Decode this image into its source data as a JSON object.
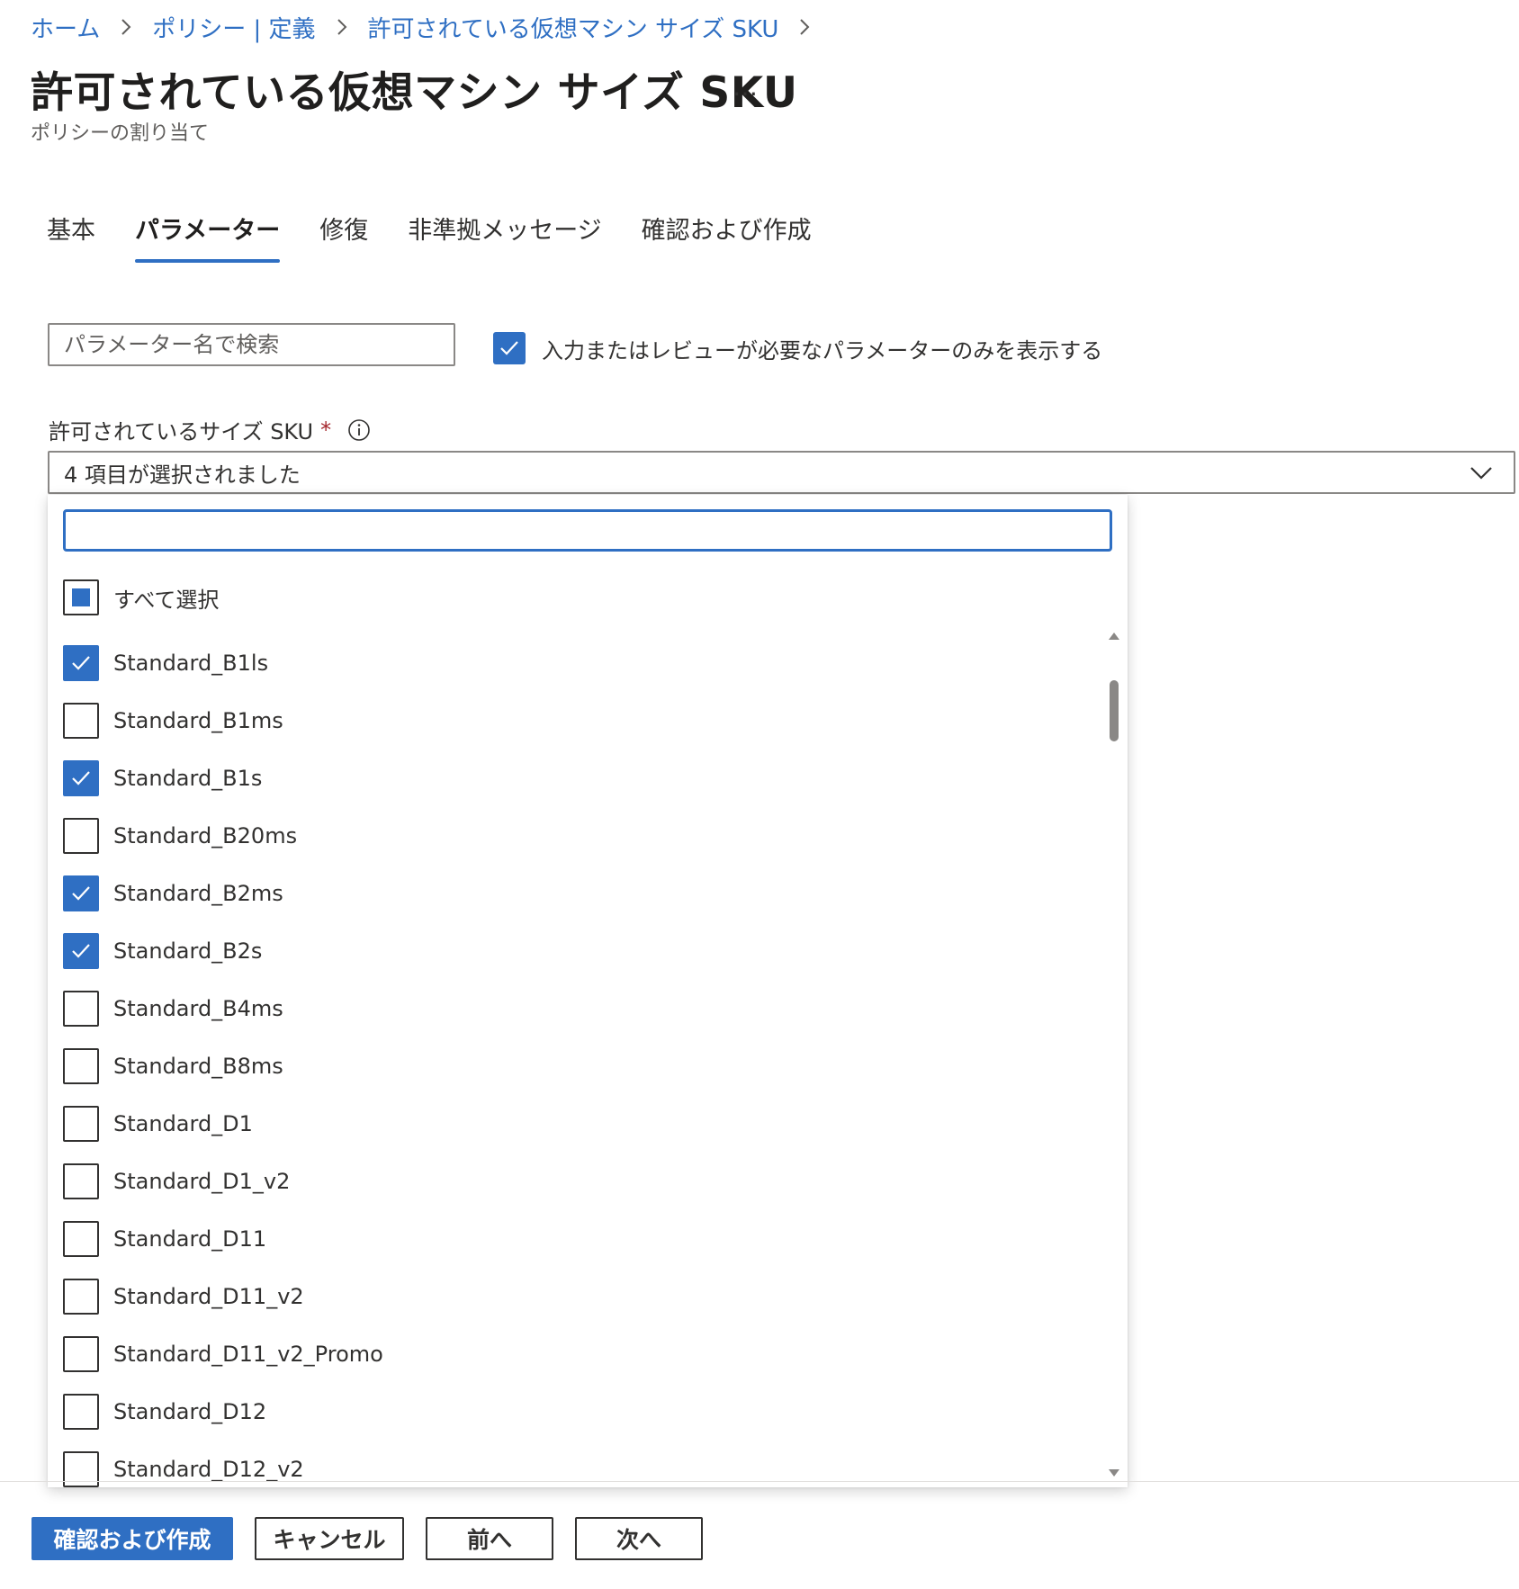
{
  "breadcrumb": {
    "items": [
      "ホーム",
      "ポリシー | 定義",
      "許可されている仮想マシン サイズ SKU"
    ]
  },
  "header": {
    "title": "許可されている仮想マシン サイズ SKU",
    "more_label": "…",
    "subtitle": "ポリシーの割り当て"
  },
  "tabs": [
    {
      "label": "基本",
      "active": false
    },
    {
      "label": "パラメーター",
      "active": true
    },
    {
      "label": "修復",
      "active": false
    },
    {
      "label": "非準拠メッセージ",
      "active": false
    },
    {
      "label": "確認および作成",
      "active": false
    }
  ],
  "parameters": {
    "search_placeholder": "パラメーター名で検索",
    "filter_checked": true,
    "filter_label": "入力またはレビューが必要なパラメーターのみを表示する",
    "field_label": "許可されているサイズ SKU",
    "required_mark": "*",
    "dropdown_value": "4 項目が選択されました"
  },
  "dropdown_panel": {
    "filter_value": "",
    "select_all_label": "すべて選択",
    "select_all_state": "indeterminate",
    "options": [
      {
        "label": "Standard_B1ls",
        "checked": true
      },
      {
        "label": "Standard_B1ms",
        "checked": false
      },
      {
        "label": "Standard_B1s",
        "checked": true
      },
      {
        "label": "Standard_B20ms",
        "checked": false
      },
      {
        "label": "Standard_B2ms",
        "checked": true
      },
      {
        "label": "Standard_B2s",
        "checked": true
      },
      {
        "label": "Standard_B4ms",
        "checked": false
      },
      {
        "label": "Standard_B8ms",
        "checked": false
      },
      {
        "label": "Standard_D1",
        "checked": false
      },
      {
        "label": "Standard_D1_v2",
        "checked": false
      },
      {
        "label": "Standard_D11",
        "checked": false
      },
      {
        "label": "Standard_D11_v2",
        "checked": false
      },
      {
        "label": "Standard_D11_v2_Promo",
        "checked": false
      },
      {
        "label": "Standard_D12",
        "checked": false
      },
      {
        "label": "Standard_D12_v2",
        "checked": false
      }
    ]
  },
  "footer": {
    "review_create_label": "確認および作成",
    "cancel_label": "キャンセル",
    "previous_label": "前へ",
    "next_label": "次へ"
  },
  "colors": {
    "accent": "#2f6fc3",
    "text": "#323130",
    "required": "#a4262c"
  }
}
